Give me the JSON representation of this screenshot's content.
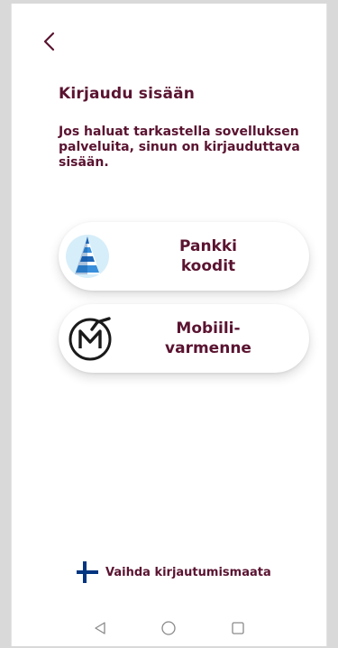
{
  "header": {
    "back_label": "<"
  },
  "page": {
    "title": "Kirjaudu sisään",
    "description": "Jos haluat tarkastella sovelluksen palveluita, sinun on kirjauduttava sisään."
  },
  "methods": [
    {
      "label": "Pankki\nkoodit",
      "icon": "bank-codes-icon"
    },
    {
      "label": "Mobiili-\nvarmenne",
      "icon": "mobile-certificate-icon"
    }
  ],
  "footer": {
    "switch_country_label": "Vaihda kirjautumismaata",
    "icon": "finnish-flag-icon"
  },
  "system_nav": {
    "back_icon": "triangle-back-icon",
    "home_icon": "circle-home-icon",
    "recents_icon": "square-recents-icon"
  },
  "colors": {
    "brand": "#5a1330",
    "flag_blue": "#003580"
  }
}
